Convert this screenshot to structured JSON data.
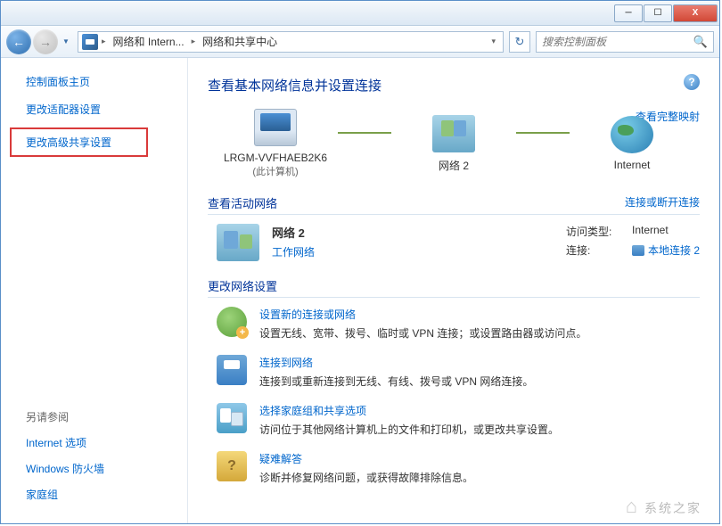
{
  "window": {
    "minimize": "─",
    "maximize": "☐",
    "close": "X"
  },
  "nav": {
    "back": "←",
    "forward": "→",
    "dropdown": "▼",
    "refresh": "↻"
  },
  "breadcrumb": {
    "item1": "网络和 Intern...",
    "item2": "网络和共享中心",
    "sep": "▸",
    "drop": "▾"
  },
  "search": {
    "placeholder": "搜索控制面板",
    "icon": "🔍"
  },
  "sidebar": {
    "home": "控制面板主页",
    "link1": "更改适配器设置",
    "link2": "更改高级共享设置",
    "seealso_title": "另请参阅",
    "seealso1": "Internet 选项",
    "seealso2": "Windows 防火墙",
    "seealso3": "家庭组"
  },
  "main": {
    "title": "查看基本网络信息并设置连接",
    "help": "?",
    "fullmap": "查看完整映射",
    "map": {
      "pc_name": "LRGM-VVFHAEB2K6",
      "pc_sub": "(此计算机)",
      "network": "网络  2",
      "internet": "Internet"
    },
    "section_active": "查看活动网络",
    "section_active_link": "连接或断开连接",
    "active": {
      "name": "网络  2",
      "type": "工作网络",
      "access_label": "访问类型:",
      "access_val": "Internet",
      "conn_label": "连接:",
      "conn_val": "本地连接 2"
    },
    "section_change": "更改网络设置",
    "settings": [
      {
        "title": "设置新的连接或网络",
        "desc": "设置无线、宽带、拨号、临时或 VPN 连接；或设置路由器或访问点。"
      },
      {
        "title": "连接到网络",
        "desc": "连接到或重新连接到无线、有线、拨号或 VPN 网络连接。"
      },
      {
        "title": "选择家庭组和共享选项",
        "desc": "访问位于其他网络计算机上的文件和打印机，或更改共享设置。"
      },
      {
        "title": "疑难解答",
        "desc": "诊断并修复网络问题，或获得故障排除信息。"
      }
    ]
  },
  "watermark": "系统之家"
}
